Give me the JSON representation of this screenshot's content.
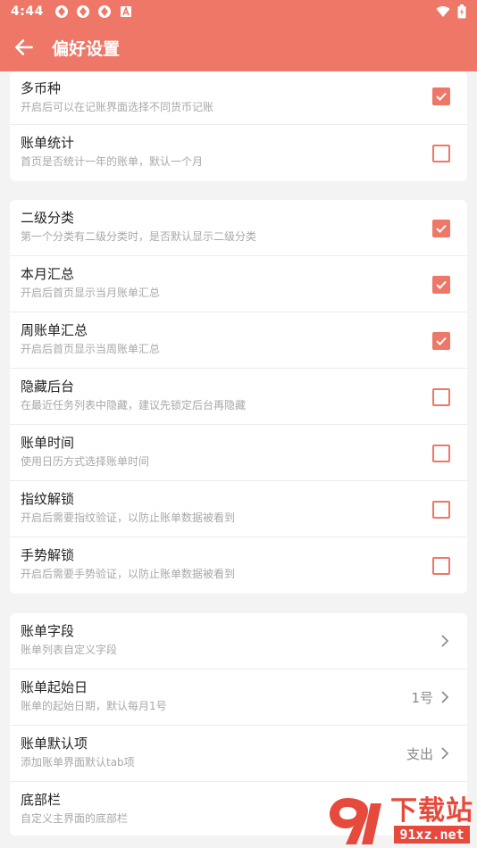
{
  "status": {
    "time": "4:44"
  },
  "appbar": {
    "title": "偏好设置"
  },
  "group1": [
    {
      "title": "多币种",
      "subtitle": "开启后可以在记账界面选择不同货币记账",
      "checked": true
    },
    {
      "title": "账单统计",
      "subtitle": "首页是否统计一年的账单，默认一个月",
      "checked": false
    }
  ],
  "group2": [
    {
      "title": "二级分类",
      "subtitle": "第一个分类有二级分类时，是否默认显示二级分类",
      "checked": true
    },
    {
      "title": "本月汇总",
      "subtitle": "开启后首页显示当月账单汇总",
      "checked": true
    },
    {
      "title": "周账单汇总",
      "subtitle": "开启后首页显示当周账单汇总",
      "checked": true
    },
    {
      "title": "隐藏后台",
      "subtitle": "在最近任务列表中隐藏，建议先锁定后台再隐藏",
      "checked": false
    },
    {
      "title": "账单时间",
      "subtitle": "使用日历方式选择账单时间",
      "checked": false
    },
    {
      "title": "指纹解锁",
      "subtitle": "开启后需要指纹验证，以防止账单数据被看到",
      "checked": false
    },
    {
      "title": "手势解锁",
      "subtitle": "开启后需要手势验证，以防止账单数据被看到",
      "checked": false
    }
  ],
  "group3": [
    {
      "title": "账单字段",
      "subtitle": "账单列表自定义字段",
      "value": ""
    },
    {
      "title": "账单起始日",
      "subtitle": "账单的起始日期，默认每月1号",
      "value": "1号"
    },
    {
      "title": "账单默认项",
      "subtitle": "添加账单界面默认tab项",
      "value": "支出"
    },
    {
      "title": "底部栏",
      "subtitle": "自定义主界面的底部栏",
      "value": ""
    }
  ],
  "watermark": {
    "cn": "下载站",
    "url": "91xz.net"
  },
  "colors": {
    "accent": "#ee7767",
    "watermark": "#e64a3c"
  }
}
